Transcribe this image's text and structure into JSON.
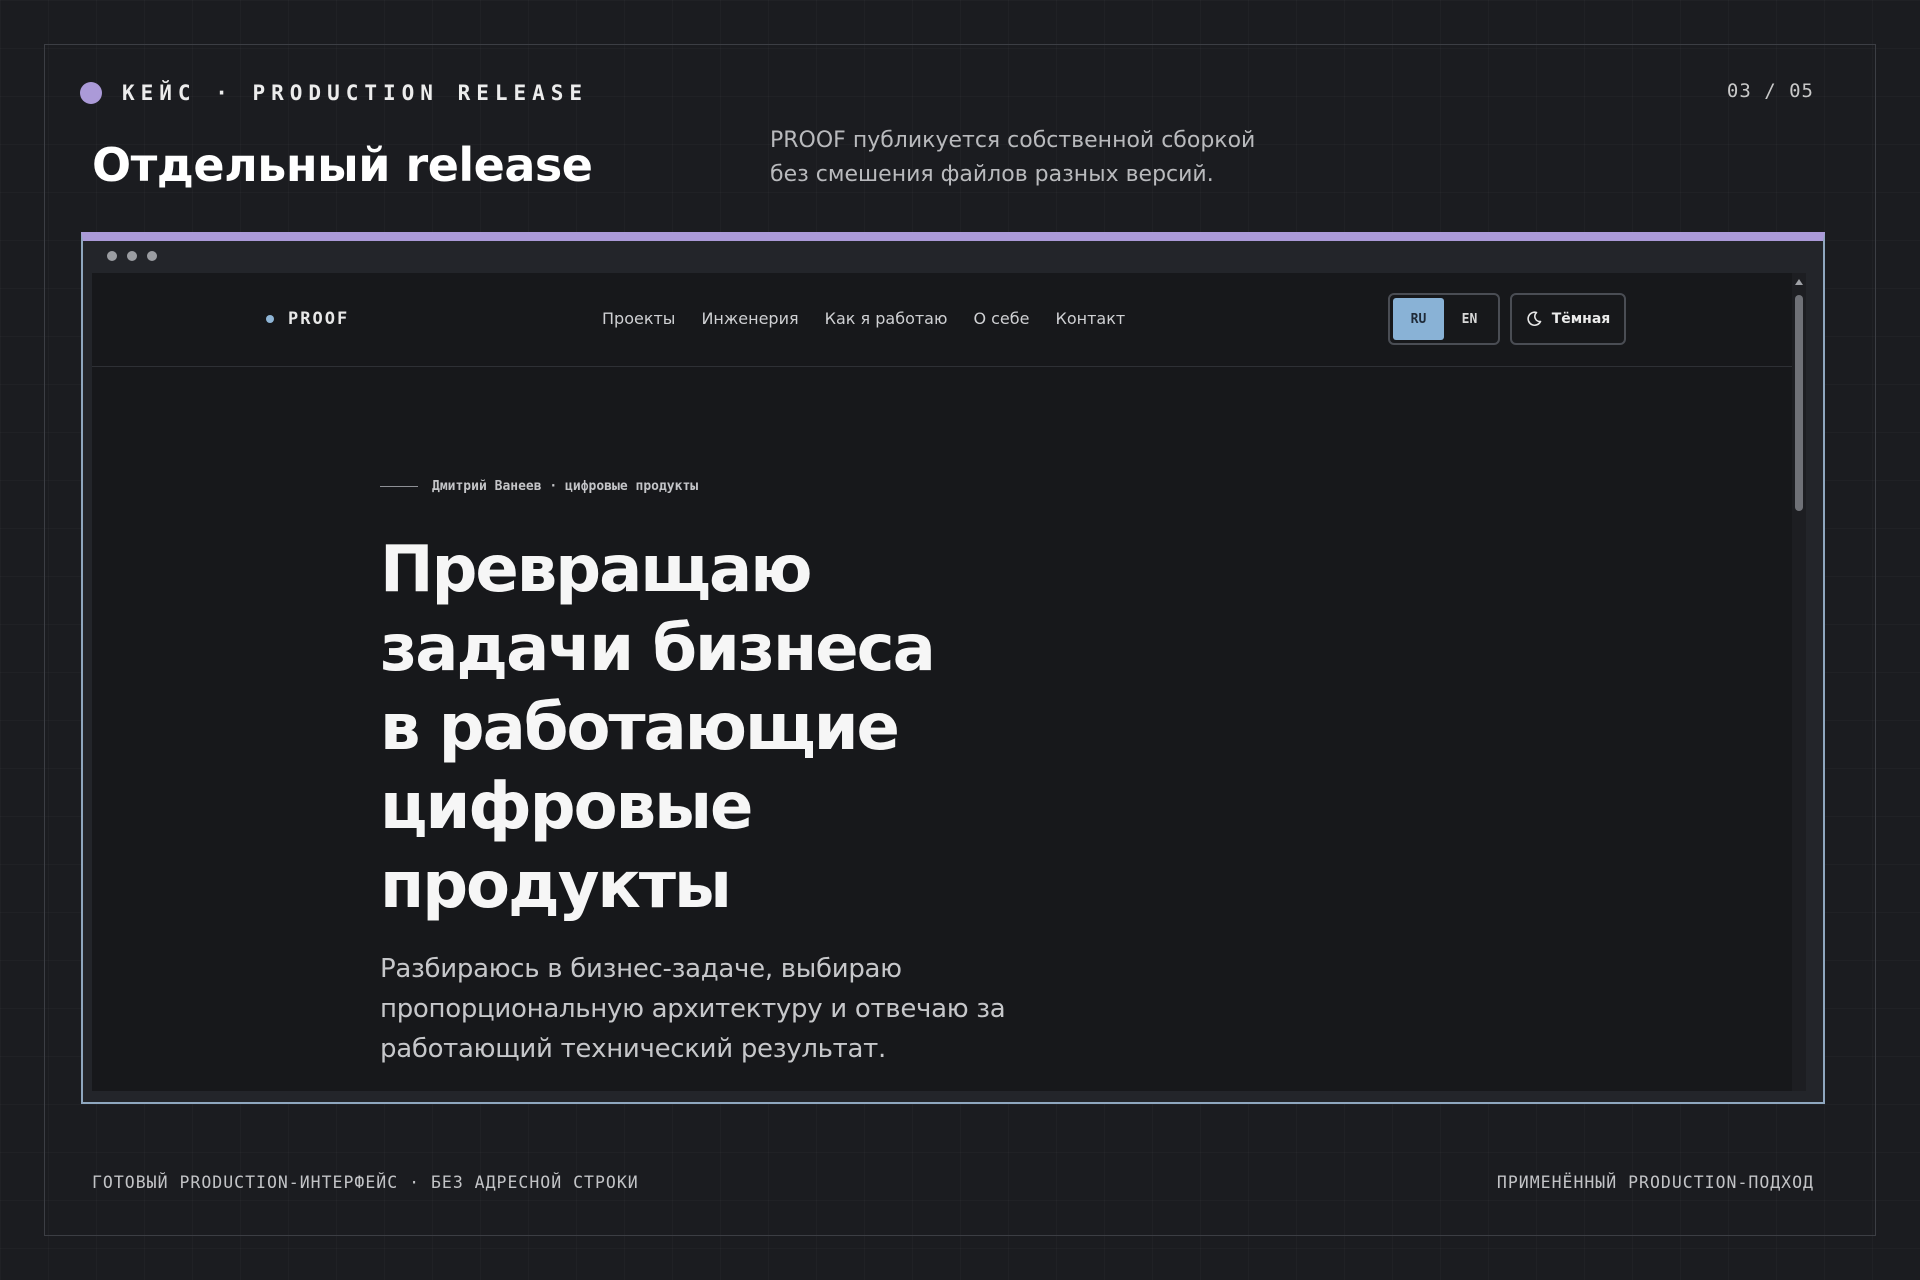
{
  "slide": {
    "kicker": "КЕЙС · PRODUCTION RELEASE",
    "page_counter": "03 / 05",
    "title": "Отдельный release",
    "description_line1": "PROOF публикуется собственной сборкой",
    "description_line2": "без смешения файлов разных версий.",
    "footer_left": "ГОТОВЫЙ PRODUCTION-ИНТЕРФЕЙС · БЕЗ АДРЕСНОЙ СТРОКИ",
    "footer_right": "ПРИМЕНЁННЫЙ PRODUCTION-ПОДХОД"
  },
  "colors": {
    "accent_purple": "#ab9ad8",
    "accent_blue": "#89b2d6",
    "background": "#1b1c20",
    "site_background": "#17181b"
  },
  "site": {
    "brand": "PROOF",
    "nav": [
      {
        "label": "Проекты"
      },
      {
        "label": "Инженерия"
      },
      {
        "label": "Как я работаю"
      },
      {
        "label": "О себе"
      },
      {
        "label": "Контакт"
      }
    ],
    "lang": {
      "ru": "RU",
      "en": "EN",
      "active": "RU"
    },
    "theme": {
      "icon": "moon-icon",
      "label": "Тёмная"
    },
    "hero": {
      "eyebrow": "Дмитрий Ванеев · цифровые продукты",
      "title_lines": [
        "Превращаю",
        "задачи бизнеса",
        "в работающие",
        "цифровые",
        "продукты"
      ],
      "subtitle_lines": [
        "Разбираюсь в бизнес-задаче, выбираю",
        "пропорциональную архитектуру и отвечаю за",
        "работающий технический результат."
      ]
    }
  }
}
